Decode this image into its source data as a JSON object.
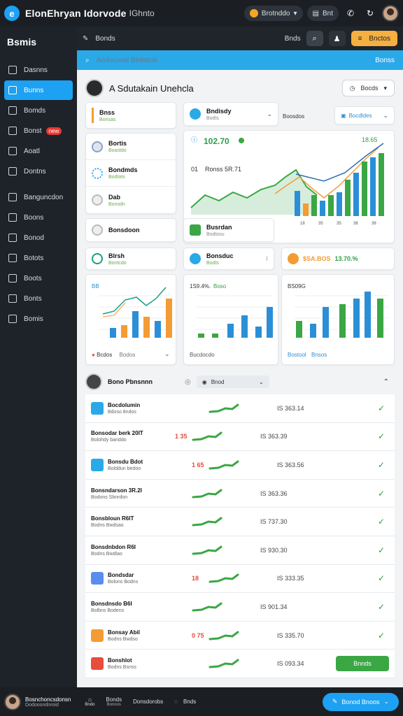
{
  "topbar": {
    "title": "ElonEhryan Idorvode",
    "subtitle": "IGhnto",
    "pill_label": "Brotnddo",
    "tab_label": "Bnt"
  },
  "sidebar": {
    "title": "Bsmis",
    "items": [
      {
        "label": "Dasnns"
      },
      {
        "label": "Bunns",
        "active": true
      },
      {
        "label": "Bomds"
      },
      {
        "label": "Bonst",
        "badge": "new"
      },
      {
        "label": "Aoatl"
      },
      {
        "label": "Dontns"
      },
      {
        "label": "Banguncdon"
      },
      {
        "label": "Boons"
      },
      {
        "label": "Bonod"
      },
      {
        "label": "Botots"
      },
      {
        "label": "Boots"
      },
      {
        "label": "Bonts"
      },
      {
        "label": "Bomis"
      }
    ]
  },
  "mainhead": {
    "breadcrumb": "Bonds",
    "search_label": "Bnds",
    "orange_label": "Bnctos"
  },
  "search": {
    "placeholder": "Aodocusst Bedatols",
    "right_label": "Bonss"
  },
  "page": {
    "title": "A Sdutakain Unehcla",
    "dropdown": "Bocds"
  },
  "cards": {
    "c1": {
      "title": "Bnss",
      "sub": "Bonsas"
    },
    "c2": {
      "title": "Bndisdy",
      "sub": "Bodts"
    },
    "c3": {
      "title": "Bortis",
      "sub": "Boastdo"
    },
    "c4": {
      "title": "Bondmds",
      "sub": "Bodtots"
    },
    "c5": {
      "title": "Dab",
      "sub": "Bonsdn"
    },
    "c6": {
      "title": "Bonsdoon",
      "sub": "Bodtunmo"
    },
    "c7": {
      "title": "Busrdan",
      "sub": "Bodtosu"
    },
    "c8": {
      "title": "Blrsh",
      "sub": "Bontcdo"
    },
    "c9": {
      "title": "Bonsduc",
      "sub": "Bodts"
    },
    "dd_label": "Boosdos",
    "dd2_label": "Bocdldes"
  },
  "bigchart": {
    "value": "102.70",
    "value2": "18.65",
    "label": "Ronss 5R.71",
    "label_prefix": "01",
    "tick_labels": [
      "18",
      "35",
      "35",
      "38",
      "38"
    ]
  },
  "stat_chip": {
    "value": "13.70.%",
    "label": "$SA.BOS"
  },
  "minicharts": {
    "m1": {
      "head": "BB",
      "foot": "Bcdos",
      "foot2": "Bodos"
    },
    "m2": {
      "head": "1S9.4%.",
      "head2": "Boso",
      "foot": "Bucdocdo"
    },
    "m3": {
      "head": "BS09G",
      "foot": "Bostool",
      "foot2": "Bnsos"
    }
  },
  "list": {
    "header": "Bono Pbnsnnn",
    "header_dd": "Bnod",
    "rows": [
      {
        "title": "Bocdolumin",
        "sub": "Bdoso 8ndos",
        "value": "IS 363.14"
      },
      {
        "title": "Bonsodar berk 20IT",
        "sub": "Bolohdy banddo",
        "value": "IS 363.39"
      },
      {
        "title": "Bonsdu Bdot",
        "sub": "Bolddun bedoo",
        "value": "IS 363.56"
      },
      {
        "title": "Bonsndarson 3R.2I",
        "sub": "Bodons Sbnrdon",
        "value": "IS 363.36"
      },
      {
        "title": "Bonsbloun R6IT",
        "sub": "Bodns Bwdsao",
        "value": "IS 737.30"
      },
      {
        "title": "Bonsdnbdon R6I",
        "sub": "Bodns Bwdlao",
        "value": "IS 930.30"
      },
      {
        "title": "Bondsdar",
        "sub": "Bolons Bodns",
        "value": "IS 333.35"
      },
      {
        "title": "Bonsdnsdo B6I",
        "sub": "Bolbns Bodens",
        "value": "IS 901.34"
      },
      {
        "title": "Bonsay Abil",
        "sub": "Bodns Bwdso",
        "value": "IS 335.70"
      },
      {
        "title": "Bonshlot",
        "sub": "Bodns Bsnss",
        "value": "IS 093.34",
        "button": "Bnnds"
      }
    ],
    "row_badges": [
      "",
      "1 35",
      "1 65",
      "",
      "",
      "",
      "18",
      "",
      "0 75",
      ""
    ]
  },
  "bottombar": {
    "user_name": "Bosnchoncsdonsn",
    "user_sub": "Dodooondnroid",
    "items": [
      {
        "label": "Bndo",
        "sub": "Bnds"
      },
      {
        "label": "Bonds",
        "sub": "Bonoos"
      },
      {
        "label": "Donsdorobs",
        "sub": ""
      },
      {
        "label": "Bnds",
        "sub": "Bnds"
      }
    ],
    "action": "Bonod Bnoos"
  },
  "colors": {
    "accent": "#1da1f2",
    "green": "#3aa744",
    "orange": "#f39c34",
    "blue": "#2a8fd6"
  }
}
